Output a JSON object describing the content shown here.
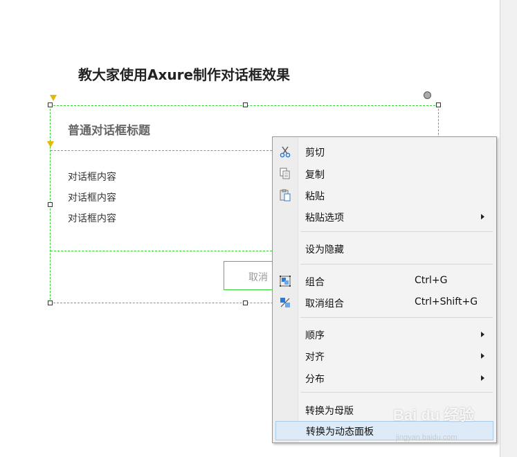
{
  "page": {
    "title": "教大家使用Axure制作对话框效果"
  },
  "dialog": {
    "title": "普通对话框标题",
    "content_lines": [
      "对话框内容",
      "对话框内容",
      "对话框内容"
    ],
    "cancel_label": "取消"
  },
  "context_menu": {
    "items": [
      {
        "label": "剪切",
        "icon": "scissors-icon"
      },
      {
        "label": "复制",
        "icon": "copy-icon"
      },
      {
        "label": "粘贴",
        "icon": "paste-icon"
      },
      {
        "label": "粘贴选项",
        "submenu": true
      },
      {
        "label": "设为隐藏"
      },
      {
        "label": "组合",
        "shortcut": "Ctrl+G",
        "icon": "group-icon"
      },
      {
        "label": "取消组合",
        "shortcut": "Ctrl+Shift+G",
        "icon": "ungroup-icon"
      },
      {
        "label": "顺序",
        "submenu": true
      },
      {
        "label": "对齐",
        "submenu": true
      },
      {
        "label": "分布",
        "submenu": true
      },
      {
        "label": "转换为母版"
      },
      {
        "label": "转换为动态面板",
        "highlighted": true
      }
    ]
  },
  "watermark": {
    "brand": "Bai du 经验",
    "url": "jingyan.baidu.com"
  },
  "colors": {
    "selection": "#2dd42d",
    "menu_highlight": "#dcebf7"
  }
}
